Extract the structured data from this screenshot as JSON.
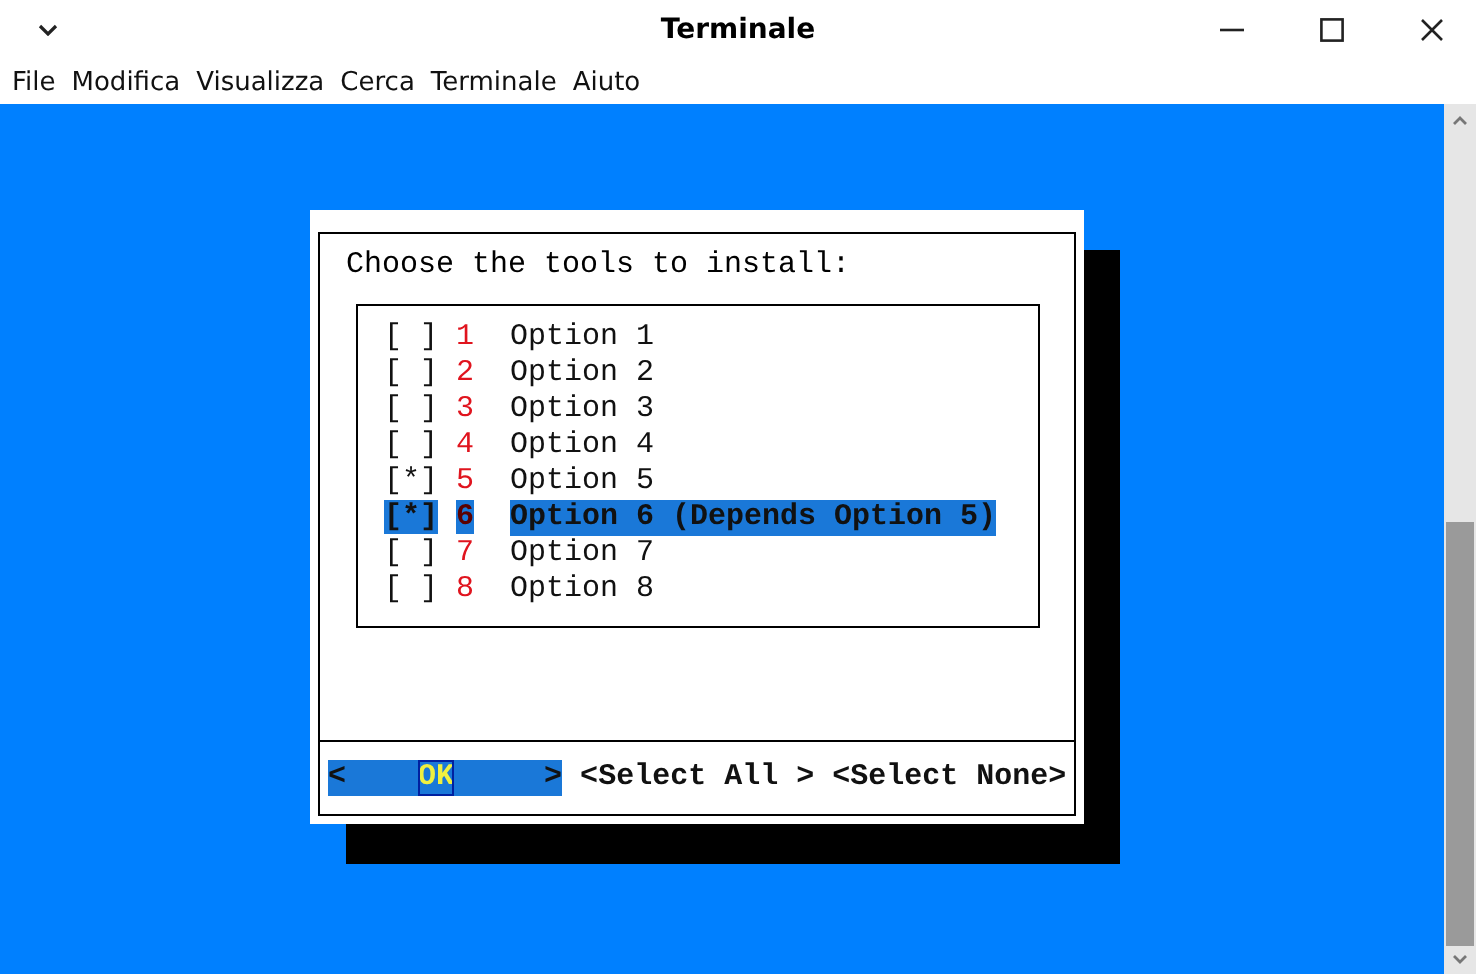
{
  "window": {
    "title": "Terminale"
  },
  "menu": [
    "File",
    "Modifica",
    "Visualizza",
    "Cerca",
    "Terminale",
    "Aiuto"
  ],
  "dialog": {
    "prompt": "Choose the tools to install:",
    "items": [
      {
        "mark": "[ ]",
        "tag": "1",
        "label": "Option 1",
        "selected": false
      },
      {
        "mark": "[ ]",
        "tag": "2",
        "label": "Option 2",
        "selected": false
      },
      {
        "mark": "[ ]",
        "tag": "3",
        "label": "Option 3",
        "selected": false
      },
      {
        "mark": "[ ]",
        "tag": "4",
        "label": "Option 4",
        "selected": false
      },
      {
        "mark": "[*]",
        "tag": "5",
        "label": "Option 5",
        "selected": false
      },
      {
        "mark": "[*]",
        "tag": "6",
        "label": "Option 6 (Depends Option 5)",
        "selected": true
      },
      {
        "mark": "[ ]",
        "tag": "7",
        "label": "Option 7",
        "selected": false
      },
      {
        "mark": "[ ]",
        "tag": "8",
        "label": "Option 8",
        "selected": false
      }
    ],
    "buttons": [
      {
        "left": "<",
        "label": "OK",
        "right": ">",
        "selected": true
      },
      {
        "left": "<",
        "label": "Select All",
        "right": " >",
        "selected": false
      },
      {
        "left": "<",
        "label": "Select None",
        "right": ">",
        "selected": false
      }
    ]
  }
}
